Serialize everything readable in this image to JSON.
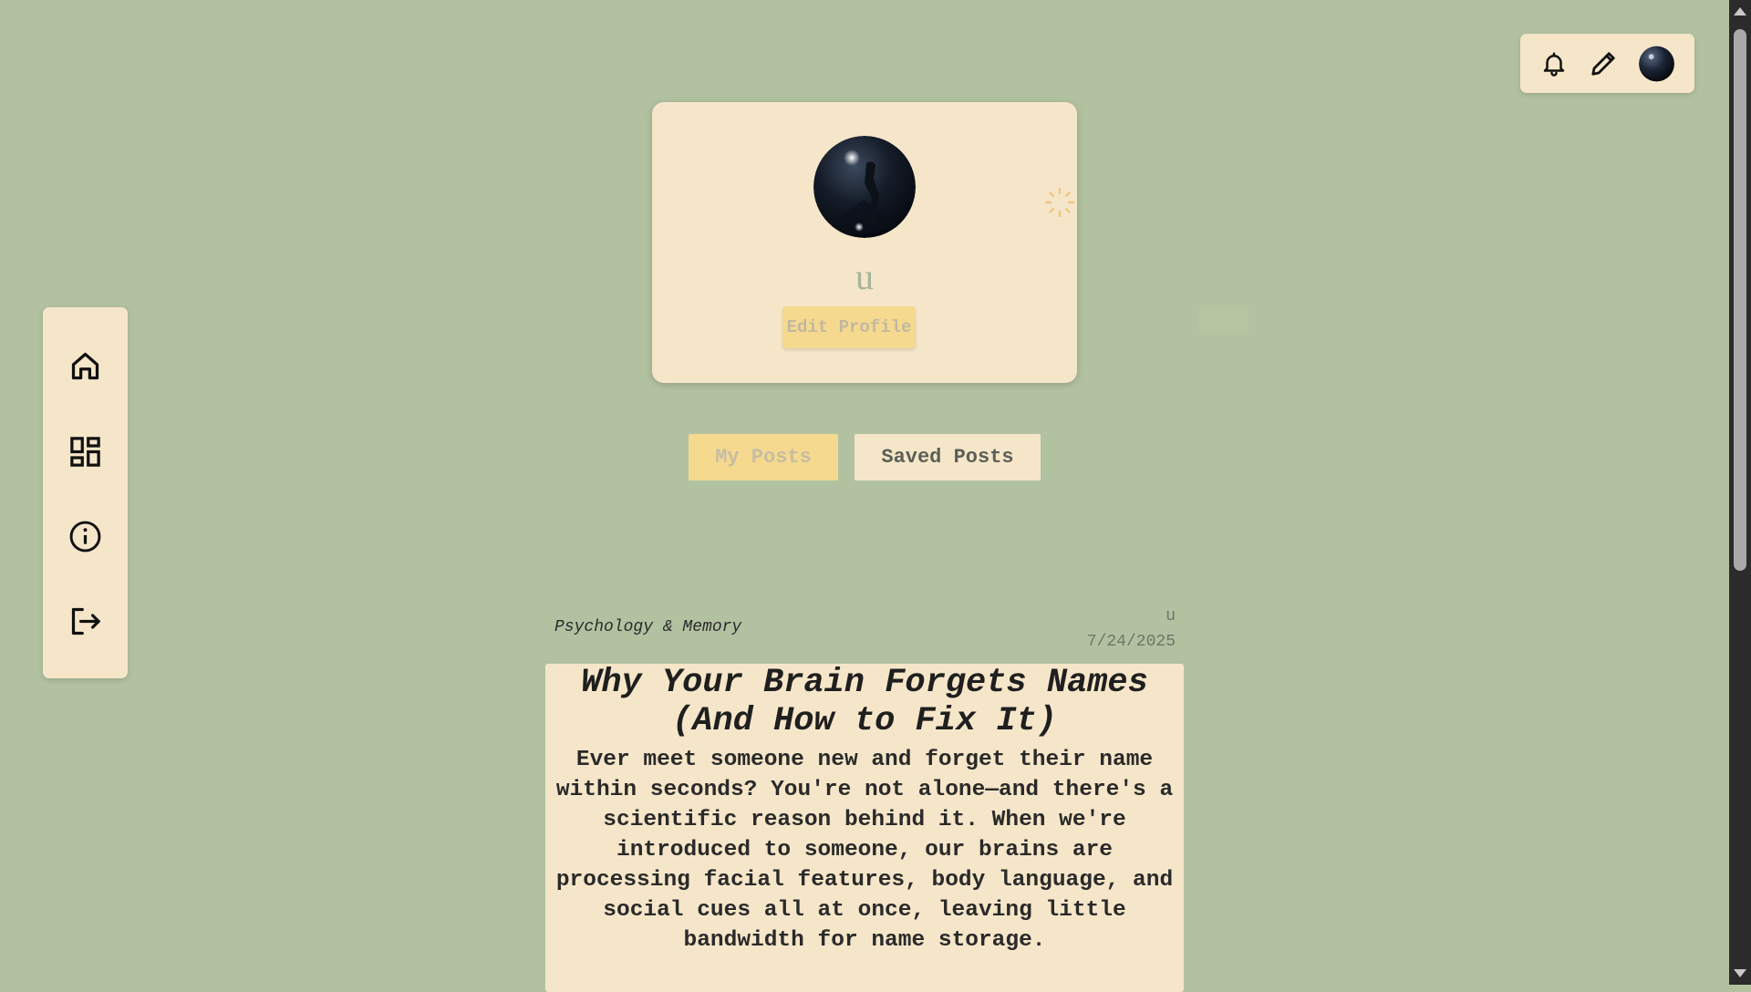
{
  "header": {
    "icons": [
      "bell-icon",
      "pencil-icon",
      "avatar"
    ]
  },
  "sidebar": {
    "items": [
      {
        "icon": "home-icon"
      },
      {
        "icon": "dashboard-icon"
      },
      {
        "icon": "info-icon"
      },
      {
        "icon": "logout-icon"
      }
    ]
  },
  "profile": {
    "username": "u",
    "edit_label": "Edit Profile"
  },
  "tabs": [
    {
      "label": "My Posts",
      "active": true
    },
    {
      "label": "Saved Posts",
      "active": false
    }
  ],
  "post": {
    "category": "Psychology & Memory",
    "author": "u",
    "date": "7/24/2025",
    "title": "Why Your Brain Forgets Names (And How to Fix It)",
    "body": "Ever meet someone new and forget their name within seconds? You're not alone—and there's a scientific reason behind it. When we're introduced to someone, our brains are processing facial features, body language, and social cues all at once, leaving little bandwidth for name storage."
  },
  "colors": {
    "background": "#b2c2a1",
    "card": "#f6e6c9",
    "accent": "#f5d98f"
  }
}
